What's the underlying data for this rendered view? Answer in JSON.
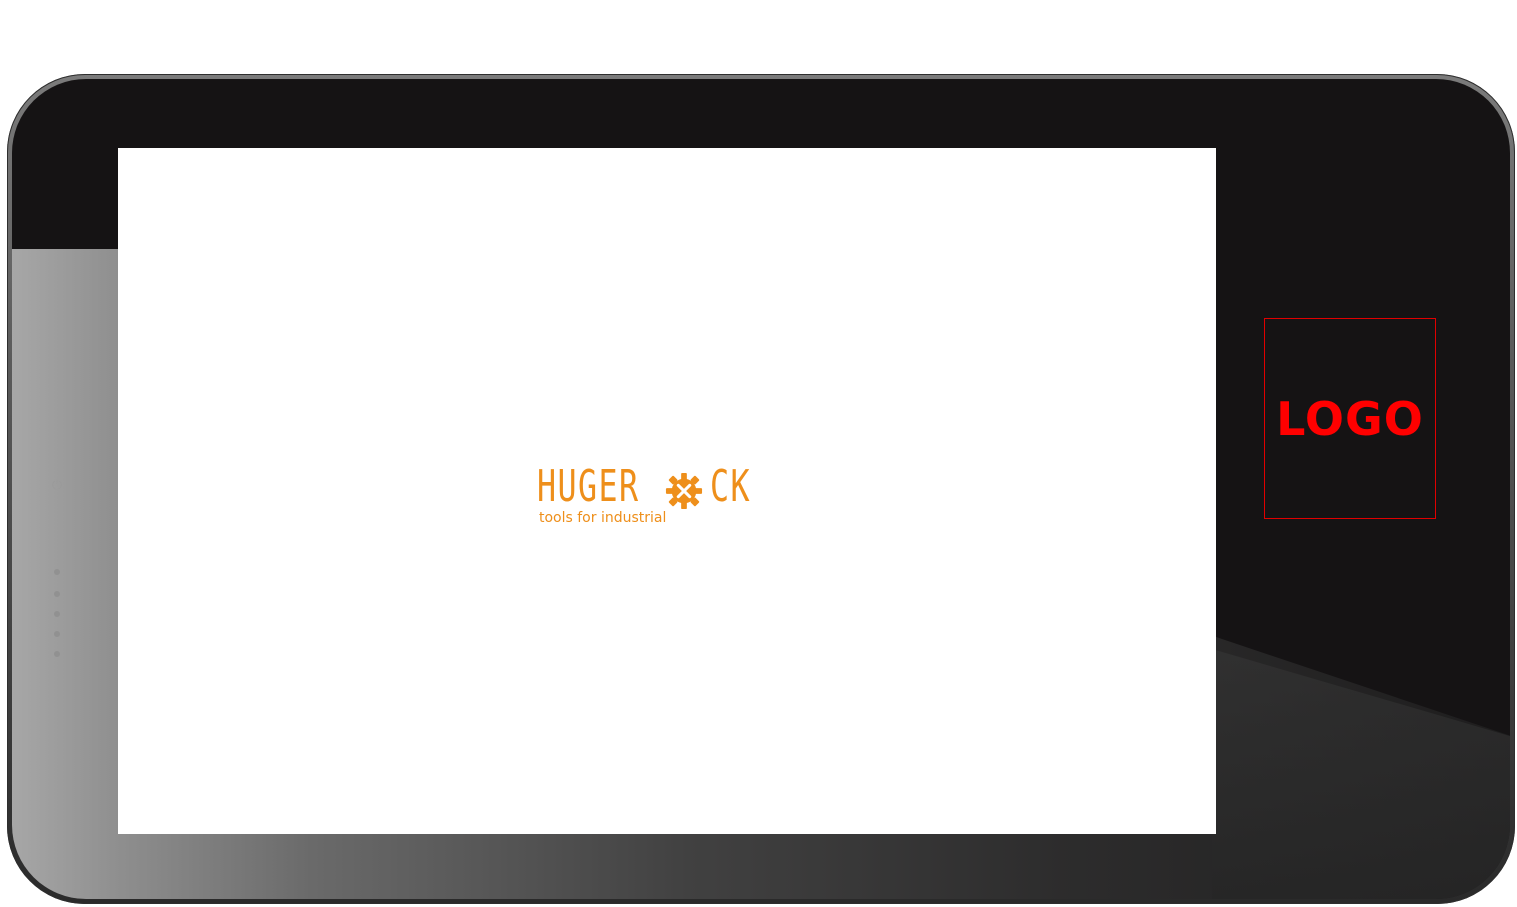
{
  "splash": {
    "brand_left": "HUGER",
    "brand_right": "CK",
    "tagline": "tools for industrial",
    "brand_color": "#ee8f1b",
    "gear_icon": "gear-icon"
  },
  "device": {
    "logo_label": "LOGO",
    "logo_color": "#ff0000",
    "power_icon": "power-icon"
  }
}
